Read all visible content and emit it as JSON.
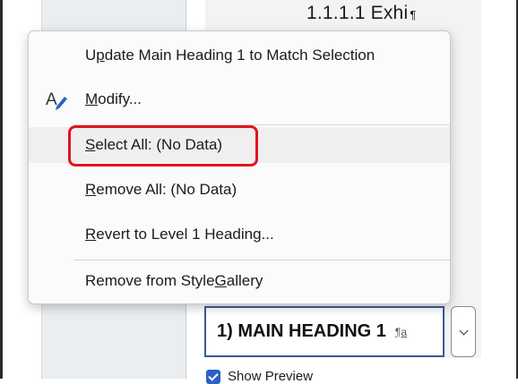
{
  "document": {
    "heading_preview": "1.1.1.1  Exhi",
    "heading_preview_mark": "¶"
  },
  "style_box": {
    "label": "1)  MAIN HEADING 1",
    "style_mark": "¶a"
  },
  "show_preview": {
    "label": "Show Preview",
    "checked": true
  },
  "context_menu": {
    "update_pre": "U",
    "update_accel": "p",
    "update_post": "date Main Heading 1 to Match Selection",
    "modify_accel": "M",
    "modify_post": "odify...",
    "select_all_accel": "S",
    "select_all_post": "elect All: (No Data)",
    "remove_all_accel": "R",
    "remove_all_post": "emove All: (No Data)",
    "revert_accel": "R",
    "revert_post": "evert to Level 1 Heading...",
    "remove_gallery_pre": "Remove from Style ",
    "remove_gallery_accel": "G",
    "remove_gallery_post": "allery"
  },
  "colors": {
    "highlight": "#e1141f",
    "accent": "#2a62c6",
    "style_box_border": "#3a5a9a"
  },
  "icons": {
    "modify": "modify-style-pen-icon",
    "dropdown": "chevron-down-icon",
    "checkbox": "checkmark-icon"
  }
}
